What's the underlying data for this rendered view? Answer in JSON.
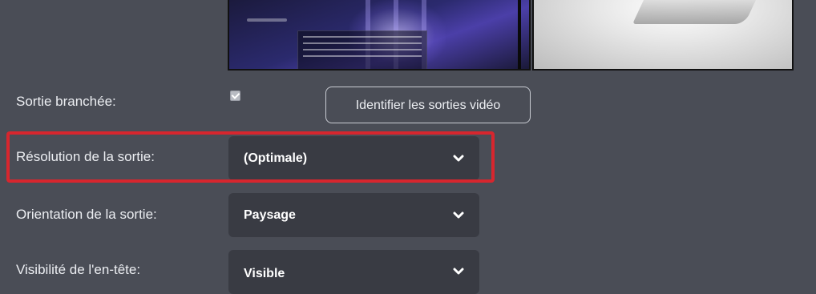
{
  "rows": {
    "output_connected": {
      "label": "Sortie branchée:",
      "checked": true
    },
    "identify_button": {
      "label": "Identifier les sorties vidéo"
    },
    "resolution": {
      "label": "Résolution de la sortie:",
      "value": "(Optimale)"
    },
    "orientation": {
      "label": "Orientation de la sortie:",
      "value": "Paysage"
    },
    "header_visibility": {
      "label": "Visibilité de l'en-tête:",
      "value": "Visible"
    }
  },
  "icons": {
    "select_arrow": "chevron-down-icon",
    "checkbox": "checkmark-icon"
  },
  "colors": {
    "background": "#4a4d56",
    "select_bg": "#393b43",
    "highlight": "#d7262e"
  }
}
